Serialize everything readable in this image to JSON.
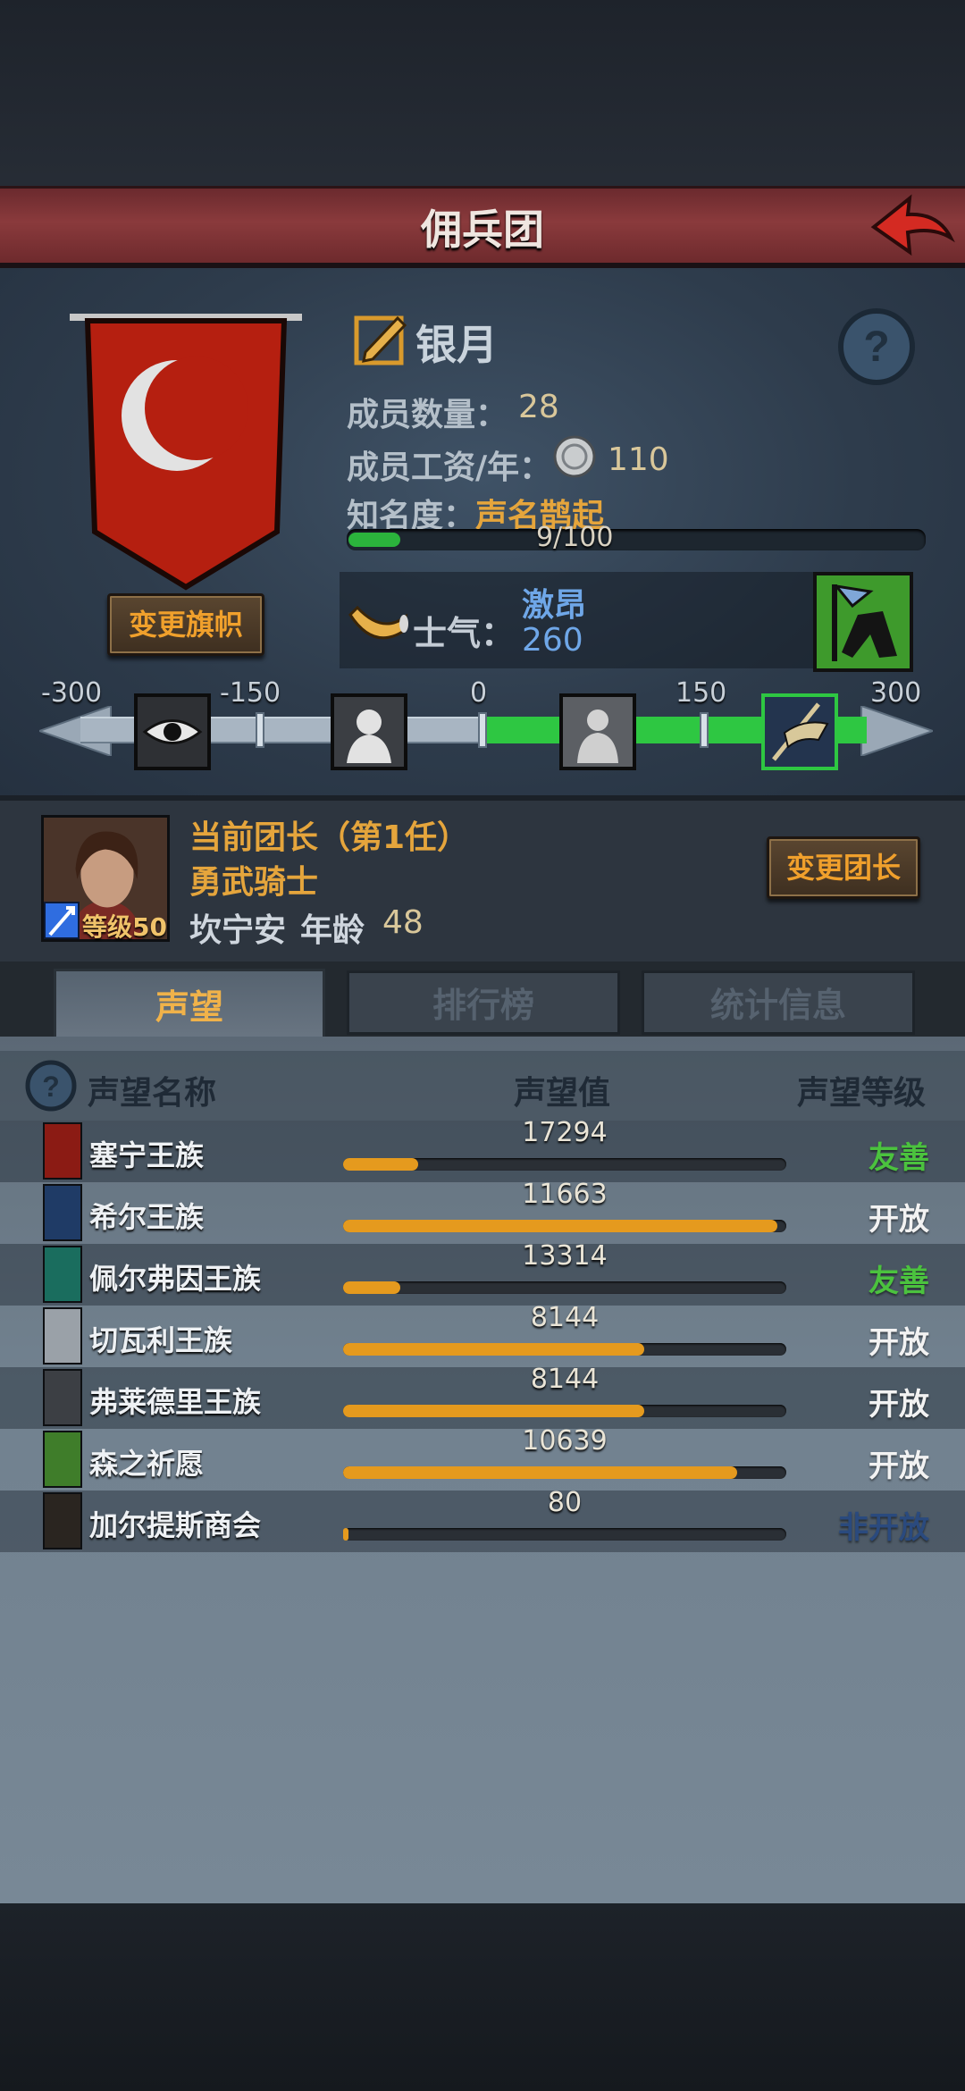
{
  "header": {
    "title": "佣兵团"
  },
  "guild": {
    "name": "银月",
    "member_count_label": "成员数量：",
    "member_count": "28",
    "salary_label": "成员工资/年：",
    "salary": "110",
    "fame_label": "知名度：",
    "fame_title": "声名鹊起",
    "fame_progress": "9/100",
    "fame_fraction": 0.09,
    "change_flag": "变更旗帜"
  },
  "morale": {
    "label": "士气：",
    "state": "激昂",
    "value": "260",
    "scale_ticks": [
      "-300",
      "-150",
      "0",
      "150",
      "300"
    ],
    "value_numeric": 260
  },
  "leader": {
    "title": "当前团长（第1任）",
    "class": "勇武骑士",
    "name": "坎宁安",
    "age_label": "年龄",
    "age": "48",
    "level": "等级50",
    "change_leader": "变更团长"
  },
  "tabs": [
    "声望",
    "排行榜",
    "统计信息"
  ],
  "table": {
    "headers": {
      "name": "声望名称",
      "value": "声望值",
      "level": "声望等级"
    },
    "rows": [
      {
        "name": "塞宁王族",
        "value": "17294",
        "fill": 0.17,
        "level": "友善",
        "level_color": "#4bc23e",
        "icon_color": "#8b1b14"
      },
      {
        "name": "希尔王族",
        "value": "11663",
        "fill": 0.98,
        "level": "开放",
        "level_color": "#f2f2f2",
        "icon_color": "#1f3b66"
      },
      {
        "name": "佩尔弗因王族",
        "value": "13314",
        "fill": 0.13,
        "level": "友善",
        "level_color": "#4bc23e",
        "icon_color": "#1a6d5e"
      },
      {
        "name": "切瓦利王族",
        "value": "8144",
        "fill": 0.68,
        "level": "开放",
        "level_color": "#f2f2f2",
        "icon_color": "#9aa1a8"
      },
      {
        "name": "弗莱德里王族",
        "value": "8144",
        "fill": 0.68,
        "level": "开放",
        "level_color": "#f2f2f2",
        "icon_color": "#3c3f44"
      },
      {
        "name": "森之祈愿",
        "value": "10639",
        "fill": 0.89,
        "level": "开放",
        "level_color": "#f2f2f2",
        "icon_color": "#3f7d2a"
      },
      {
        "name": "加尔提斯商会",
        "value": "80",
        "fill": 0.01,
        "level": "非开放",
        "level_color": "#2a4a7e",
        "icon_color": "#2a2520"
      }
    ]
  }
}
